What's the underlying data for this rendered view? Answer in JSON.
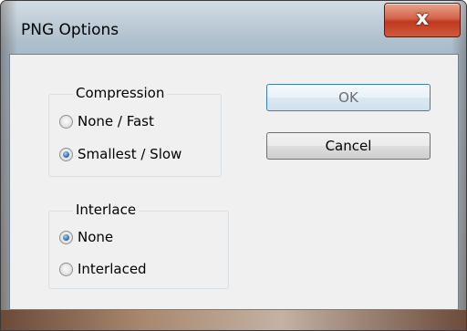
{
  "window": {
    "title": "PNG Options",
    "close_icon": "x-icon",
    "close_glyph": "x"
  },
  "compression": {
    "label": "Compression",
    "options": [
      {
        "label": "None / Fast",
        "checked": false
      },
      {
        "label": "Smallest / Slow",
        "checked": true
      }
    ]
  },
  "interlace": {
    "label": "Interlace",
    "options": [
      {
        "label": "None",
        "checked": true
      },
      {
        "label": "Interlaced",
        "checked": false
      }
    ]
  },
  "buttons": {
    "ok_label": "OK",
    "cancel_label": "Cancel"
  },
  "colors": {
    "close_button": "#c0391f",
    "radio_dot": "#2f6fae",
    "default_button_border": "#3c7fb1"
  }
}
